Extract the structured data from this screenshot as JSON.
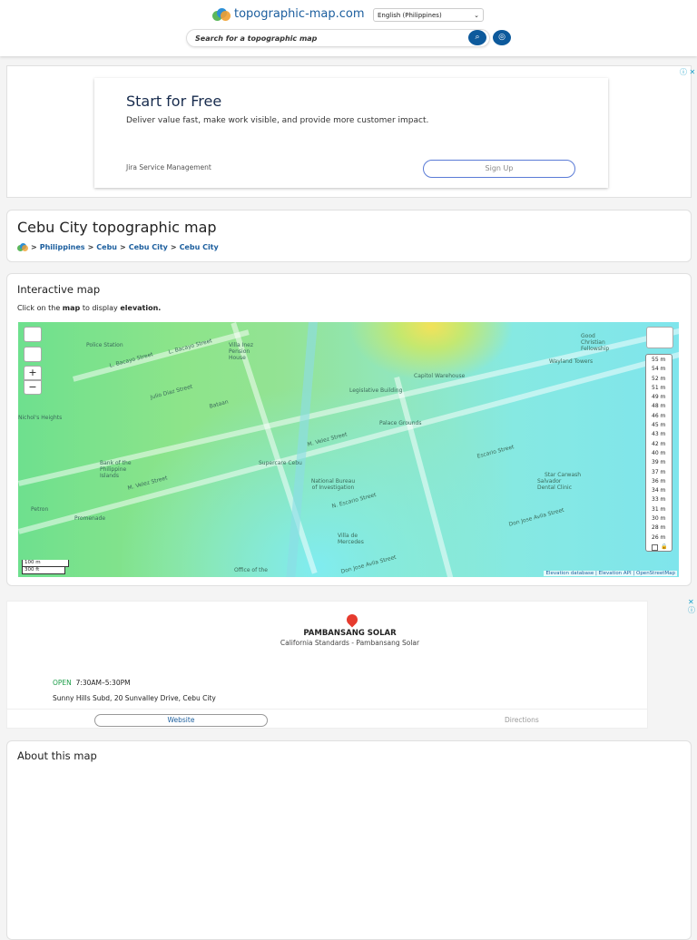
{
  "header": {
    "site_name": "topographic-map.com",
    "language": "English (Philippines)",
    "search_placeholder": "Search for a topographic map"
  },
  "ad_top": {
    "headline": "Start for Free",
    "body": "Deliver value fast, make work visible, and provide more customer impact.",
    "brand": "Jira Service Management",
    "cta": "Sign Up"
  },
  "page": {
    "title": "Cebu City topographic map",
    "breadcrumb": [
      "Philippines",
      "Cebu",
      "Cebu City",
      "Cebu City"
    ],
    "separator": ">"
  },
  "map_section": {
    "heading": "Interactive map",
    "hint_prefix": "Click on the",
    "hint_map": "map",
    "hint_middle": "to display",
    "hint_elev": "elevation.",
    "zoom_in": "+",
    "zoom_out": "−",
    "legend": [
      "55 m",
      "54 m",
      "52 m",
      "51 m",
      "49 m",
      "48 m",
      "46 m",
      "45 m",
      "43 m",
      "42 m",
      "40 m",
      "39 m",
      "37 m",
      "36 m",
      "34 m",
      "33 m",
      "31 m",
      "30 m",
      "28 m",
      "26 m"
    ],
    "scale_m": "100 m",
    "scale_ft": "300 ft",
    "attribution": [
      "Elevation database",
      "Elevation API",
      "OpenStreetMap"
    ],
    "labels": [
      "L. Bacayo Street",
      "L. Bacayo Street",
      "Julio Diaz Street",
      "Bataan",
      "M. Velez Street",
      "M. Velez Street",
      "Legislative Building",
      "Capitol Warehouse",
      "Palace Grounds",
      "Escario Street",
      "N. Escario Street",
      "Don Jose Avila Street",
      "Don Jose Avila Street",
      "National Bureau of Investigation",
      "Supercare Cebu",
      "Nichol's Heights",
      "Promenade",
      "Police Station",
      "Villa Inez Pension House",
      "Bank of the Philippine Islands",
      "Petron",
      "Wayland Towers",
      "Good Christian Fellowship",
      "Salvador Dental Clinic",
      "Star Carwash",
      "Villa de Mercedes",
      "Office of the"
    ]
  },
  "ad_bottom": {
    "title": "PAMBANSANG SOLAR",
    "subtitle": "California Standards - Pambansang Solar",
    "status": "OPEN",
    "hours": "7:30AM–5:30PM",
    "address": "Sunny Hills Subd, 20 Sunvalley Drive, Cebu City",
    "website": "Website",
    "directions": "Directions"
  },
  "about": {
    "heading": "About this map"
  },
  "colors": {
    "brand": "#1b5e9e",
    "open": "#1e9e4a"
  }
}
